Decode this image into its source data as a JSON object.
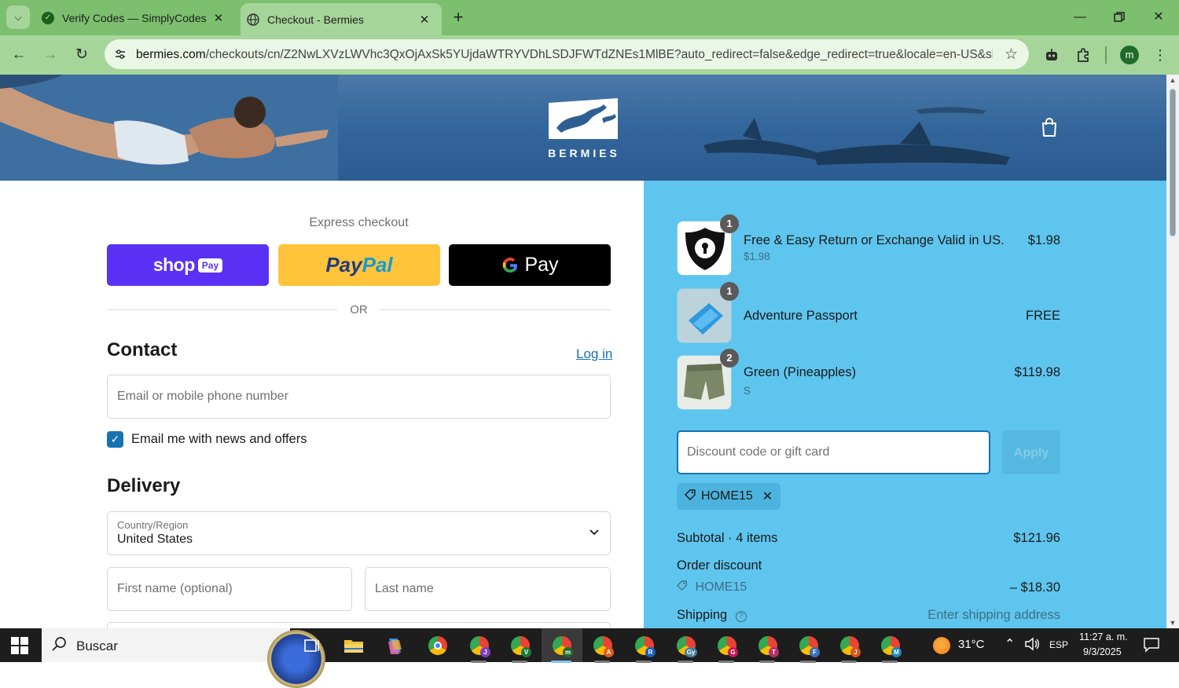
{
  "browser": {
    "tabs": [
      {
        "title": "Verify Codes — SimplyCodes",
        "active": false
      },
      {
        "title": "Checkout - Bermies",
        "active": true
      }
    ],
    "url_host": "bermies.com",
    "url_path": "/checkouts/cn/Z2NwLXVzLWVhc3QxOjAxSk5YUjdaWTRYVDhLSDJFWTdZNEs1MlBE?auto_redirect=false&edge_redirect=true&locale=en-US&skip_...",
    "profile_initial": "m",
    "colors": {
      "frame": "#7cbf6e",
      "toolbar": "#a6d59a"
    }
  },
  "header": {
    "brand": "BERMIES"
  },
  "checkout": {
    "express_title": "Express checkout",
    "shop_pay": {
      "word": "shop",
      "chip": "Pay"
    },
    "paypal": {
      "part1": "Pay",
      "part2": "Pal"
    },
    "gpay": {
      "g": "G",
      "word": "Pay"
    },
    "or_label": "OR",
    "contact": {
      "heading": "Contact",
      "login_link": "Log in",
      "email_placeholder": "Email or mobile phone number",
      "newsletter_label": "Email me with news and offers",
      "newsletter_checked": true
    },
    "delivery": {
      "heading": "Delivery",
      "country_label": "Country/Region",
      "country_value": "United States",
      "first_name_placeholder": "First name (optional)",
      "last_name_placeholder": "Last name"
    }
  },
  "summary": {
    "items": [
      {
        "name": "Free & Easy Return or Exchange Valid in US.",
        "sub": "$1.98",
        "price": "$1.98",
        "qty": "1"
      },
      {
        "name": "Adventure Passport",
        "sub": "",
        "price": "FREE",
        "qty": "1"
      },
      {
        "name": "Green (Pineapples)",
        "sub": "S",
        "price": "$119.98",
        "qty": "2"
      }
    ],
    "discount_placeholder": "Discount code or gift card",
    "apply_label": "Apply",
    "applied_code": "HOME15",
    "subtotal_label": "Subtotal · 4 items",
    "subtotal_value": "$121.96",
    "order_discount_label": "Order discount",
    "discount_code_label": "HOME15",
    "discount_value": "– $18.30",
    "shipping_label": "Shipping",
    "shipping_value": "Enter shipping address",
    "colors": {
      "panel": "#5ec5ee",
      "accent": "#1773b0"
    }
  },
  "taskbar": {
    "search_label": "Buscar",
    "temperature": "31°C",
    "language": "ESP",
    "time": "11:27 a. m.",
    "date": "9/3/2025",
    "chrome_profiles": [
      "J",
      "V",
      "m",
      "A",
      "R",
      "Gy",
      "G",
      "T",
      "F",
      "J",
      "M"
    ]
  }
}
